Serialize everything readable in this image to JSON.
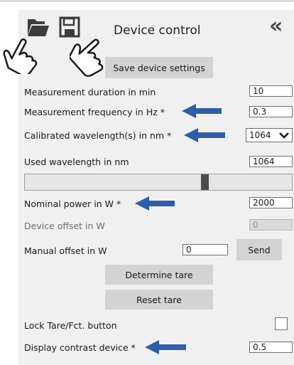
{
  "header": {
    "title": "Device control",
    "collapse_glyph": "«",
    "icons": [
      "folder-open-icon",
      "save-icon",
      "hand-pointer-icon"
    ]
  },
  "buttons": {
    "save_settings": "Save device settings",
    "send": "Send",
    "determine_tare": "Determine tare",
    "reset_tare": "Reset tare"
  },
  "fields": {
    "measurement_duration": {
      "label": "Measurement duration in min",
      "value": "10"
    },
    "measurement_frequency": {
      "label": "Measurement frequency in Hz *",
      "value": "0.3"
    },
    "calibrated_wavelength": {
      "label": "Calibrated wavelength(s) in nm *",
      "value": "1064",
      "chevron": "❯"
    },
    "used_wavelength": {
      "label": "Used wavelength in nm",
      "value": "1064",
      "slider_fraction": 0.68
    },
    "nominal_power": {
      "label": "Nominal power in W *",
      "value": "2000"
    },
    "device_offset": {
      "label": "Device offset in W",
      "value": "0"
    },
    "manual_offset": {
      "label": "Manual offset in W",
      "value": "0"
    },
    "lock_tare": {
      "label": "Lock Tare/Fct. button",
      "checked": false
    },
    "display_contrast": {
      "label": "Display contrast device *",
      "value": "0.5"
    }
  },
  "colors": {
    "panel_bg": "#f0f0f0",
    "button_bg": "#d3d3d3",
    "arrow_blue": "#2f5ea8",
    "disabled_bg": "#d9d9d9"
  }
}
